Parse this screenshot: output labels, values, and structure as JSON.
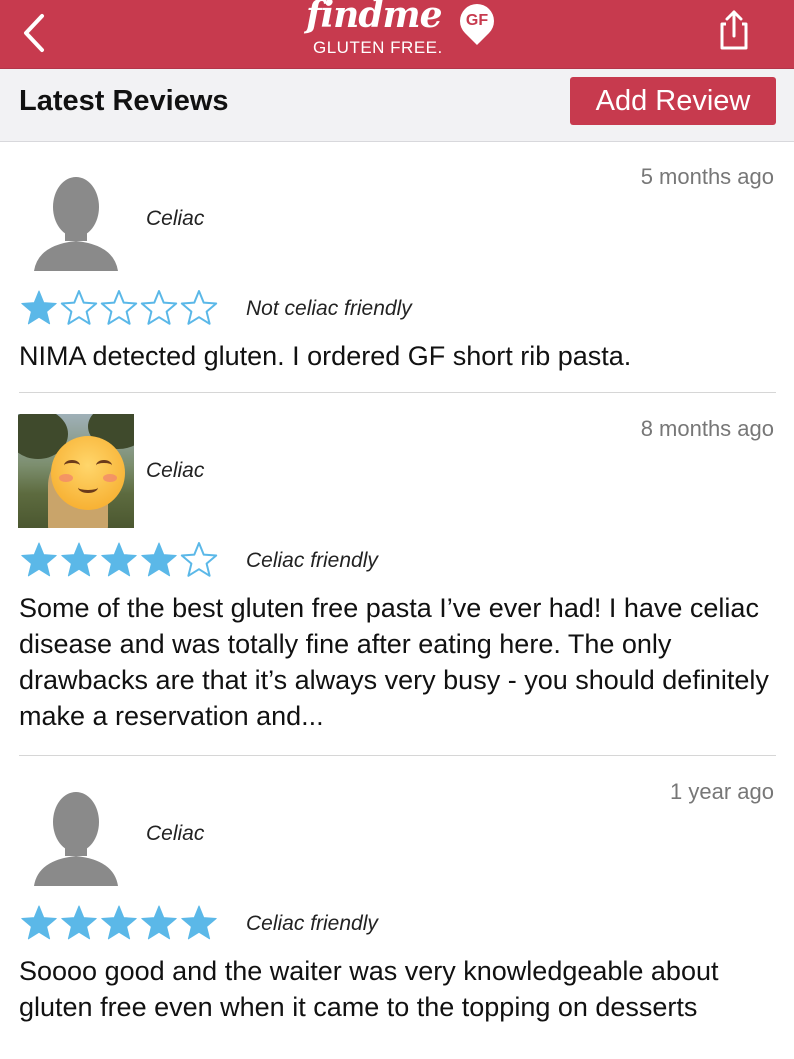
{
  "header": {
    "logo_word": "findme",
    "logo_badge": "GF",
    "logo_sub": "GLUTEN FREE.",
    "back_icon": "chevron-left-icon",
    "share_icon": "share-icon",
    "brand_color": "#c73a4e"
  },
  "subheader": {
    "title": "Latest Reviews",
    "add_review_label": "Add Review"
  },
  "reviews": [
    {
      "time": "5 months ago",
      "role": "Celiac",
      "rating": 1,
      "rating_max": 5,
      "rating_label": "Not celiac friendly",
      "text": "NIMA detected gluten. I ordered GF short rib pasta.",
      "avatar": "default-avatar"
    },
    {
      "time": "8 months ago",
      "role": "Celiac",
      "rating": 4,
      "rating_max": 5,
      "rating_label": "Celiac friendly",
      "text": "Some of the best gluten free pasta I’ve ever had! I have celiac disease and was totally fine after eating here. The only drawbacks are that it’s always very busy - you should definitely make a reservation and...",
      "avatar": "photo-avatar"
    },
    {
      "time": "1 year ago",
      "role": "Celiac",
      "rating": 5,
      "rating_max": 5,
      "rating_label": "Celiac friendly",
      "text": "Soooo good and the waiter was very knowledgeable about gluten free even when it came to the topping on desserts",
      "avatar": "default-avatar"
    }
  ],
  "star_color": "#5bb8e8"
}
